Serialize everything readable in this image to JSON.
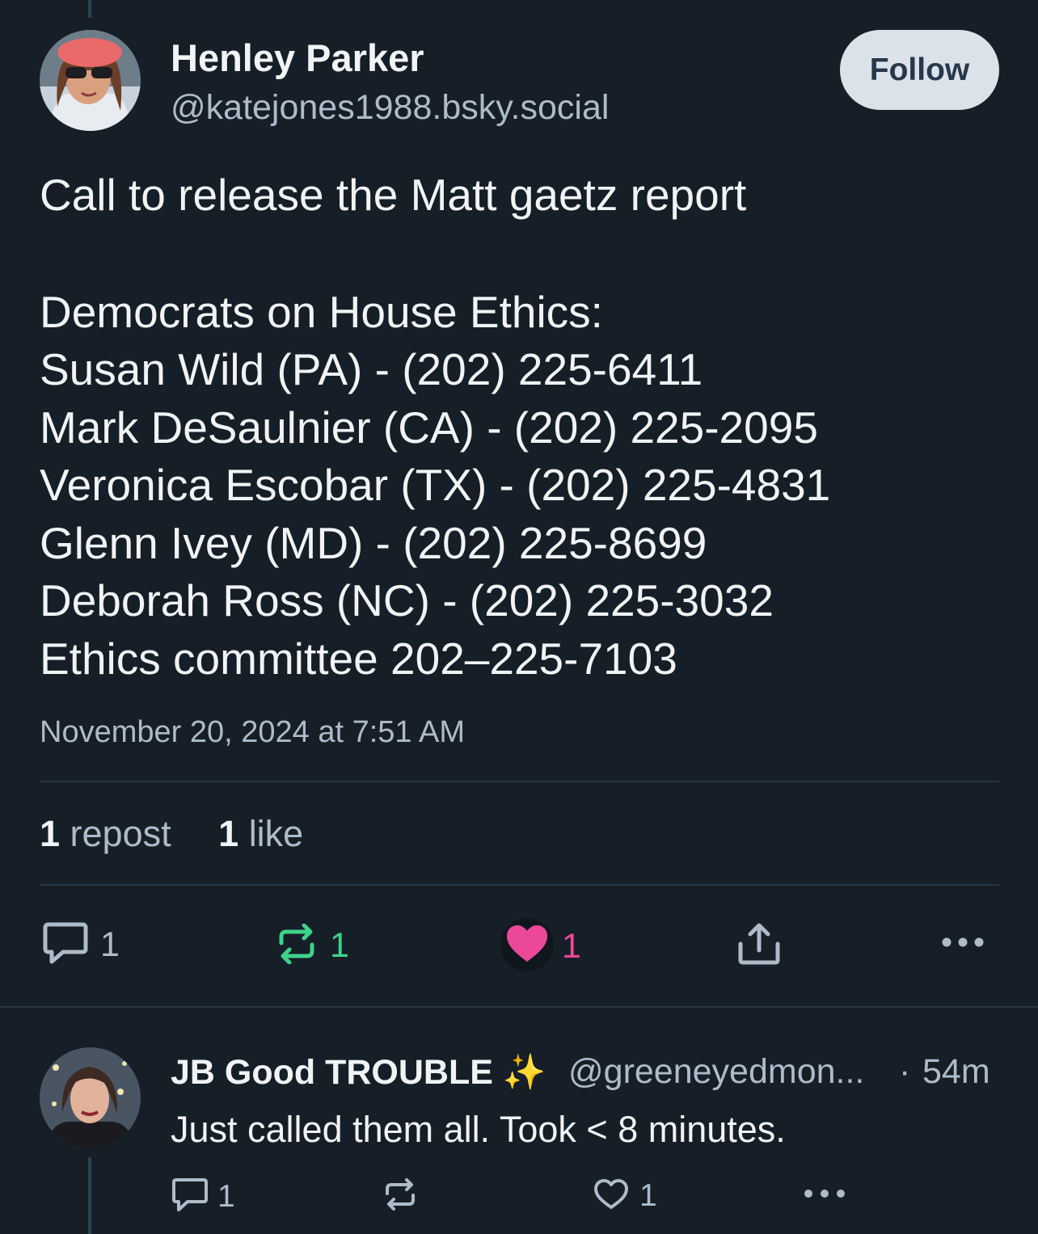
{
  "post": {
    "author_name": "Henley Parker",
    "author_handle": "@katejones1988.bsky.social",
    "follow_label": "Follow",
    "body_lines": [
      "Call to release the Matt gaetz report",
      "",
      "Democrats on House Ethics:",
      "Susan Wild (PA) - (202) 225-6411",
      "Mark DeSaulnier (CA) - (202) 225-2095",
      "Veronica Escobar (TX) - (202) 225-4831",
      "Glenn Ivey (MD) - (202) 225-8699",
      "Deborah Ross (NC) - (202) 225-3032",
      "Ethics committee 202–225-7103"
    ],
    "timestamp": "November 20, 2024 at 7:51 AM",
    "stats": {
      "reposts_count": "1",
      "reposts_label": "repost",
      "likes_count": "1",
      "likes_label": "like"
    },
    "actions": {
      "reply_count": "1",
      "repost_count": "1",
      "like_count": "1"
    }
  },
  "reply": {
    "author_name": "JB Good TROUBLE",
    "emoji": "✨",
    "author_handle": "@greeneyedmon...",
    "separator": "·",
    "time": "54m",
    "text": "Just called them all. Took < 8 minutes.",
    "actions": {
      "reply_count": "1",
      "like_count": "1"
    }
  },
  "colors": {
    "background": "#161e27",
    "text_primary": "#f1f3f5",
    "text_secondary": "#aebbc9",
    "repost_active": "#3ed28b",
    "like_active": "#ec4899",
    "follow_bg": "#dce2ea",
    "divider": "#263545"
  },
  "icons": [
    "reply-icon",
    "repost-icon",
    "heart-icon",
    "share-icon",
    "more-icon"
  ]
}
